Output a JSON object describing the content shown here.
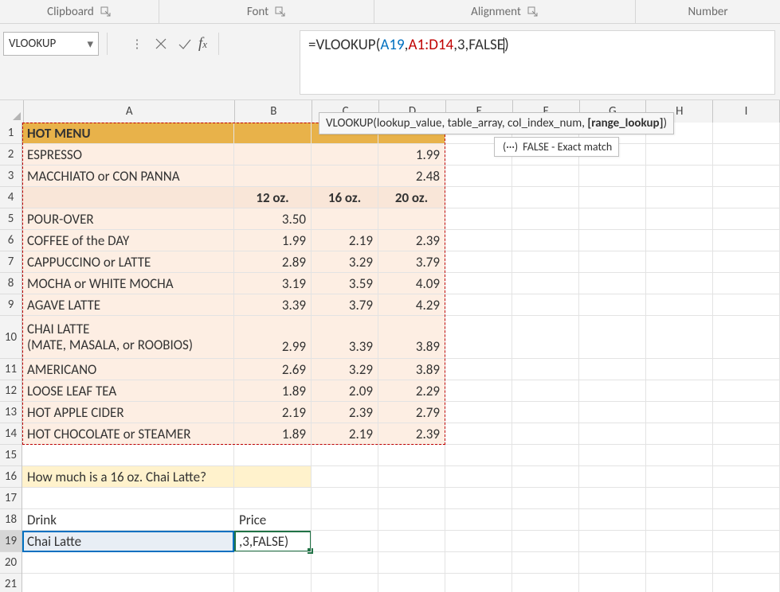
{
  "ribbon": {
    "groups": {
      "clipboard": "Clipboard",
      "font": "Font",
      "alignment": "Alignment",
      "number": "Number"
    }
  },
  "namebox": {
    "value": "VLOOKUP"
  },
  "formula_bar": {
    "prefix": "=VLOOKUP(",
    "ref1": "A19",
    "comma1": ",",
    "ref2": "A1:D14",
    "suffix": ",3,FALSE)",
    "full": "=VLOOKUP(A19,A1:D14,3,FALSE)"
  },
  "tooltip": {
    "signature_prefix": "VLOOKUP(lookup_value, table_array, col_index_num, ",
    "signature_bold": "[range_lookup]",
    "signature_suffix": ")",
    "option_icon": "(···)",
    "option_text": "FALSE - Exact match"
  },
  "columns": [
    "A",
    "B",
    "C",
    "D",
    "E",
    "F",
    "G",
    "H",
    "I"
  ],
  "row_numbers": [
    1,
    2,
    3,
    4,
    5,
    6,
    7,
    8,
    9,
    10,
    11,
    12,
    13,
    14,
    15,
    16,
    17,
    18,
    19,
    20,
    21
  ],
  "menu": {
    "title": "HOT MENU",
    "row2": {
      "name": "ESPRESSO",
      "price_d": "1.99"
    },
    "row3": {
      "name": "MACCHIATO or CON PANNA",
      "price_d": "2.48"
    },
    "size_headers": {
      "b": "12 oz.",
      "c": "16 oz.",
      "d": "20 oz."
    },
    "items": [
      {
        "name": "POUR-OVER",
        "b": "3.50",
        "c": "",
        "d": ""
      },
      {
        "name": "COFFEE of the DAY",
        "b": "1.99",
        "c": "2.19",
        "d": "2.39"
      },
      {
        "name": "CAPPUCCINO or LATTE",
        "b": "2.89",
        "c": "3.29",
        "d": "3.79"
      },
      {
        "name": "MOCHA or WHITE MOCHA",
        "b": "3.19",
        "c": "3.59",
        "d": "4.09"
      },
      {
        "name": "AGAVE LATTE",
        "b": "3.39",
        "c": "3.79",
        "d": "4.29"
      },
      {
        "name": "CHAI LATTE\n(MATE, MASALA, or ROOBIOS)",
        "b": "2.99",
        "c": "3.39",
        "d": "3.89"
      },
      {
        "name": "AMERICANO",
        "b": "2.69",
        "c": "3.29",
        "d": "3.89"
      },
      {
        "name": "LOOSE LEAF TEA",
        "b": "1.89",
        "c": "2.09",
        "d": "2.29"
      },
      {
        "name": "HOT APPLE CIDER",
        "b": "2.19",
        "c": "2.39",
        "d": "2.79"
      },
      {
        "name": "HOT CHOCOLATE or STEAMER",
        "b": "1.89",
        "c": "2.19",
        "d": "2.39"
      }
    ]
  },
  "question_row": "How much is a 16 oz. Chai Latte?",
  "labels": {
    "drink": "Drink",
    "price": "Price"
  },
  "a19": "Chai Latte",
  "b19_display": ",3,FALSE)"
}
